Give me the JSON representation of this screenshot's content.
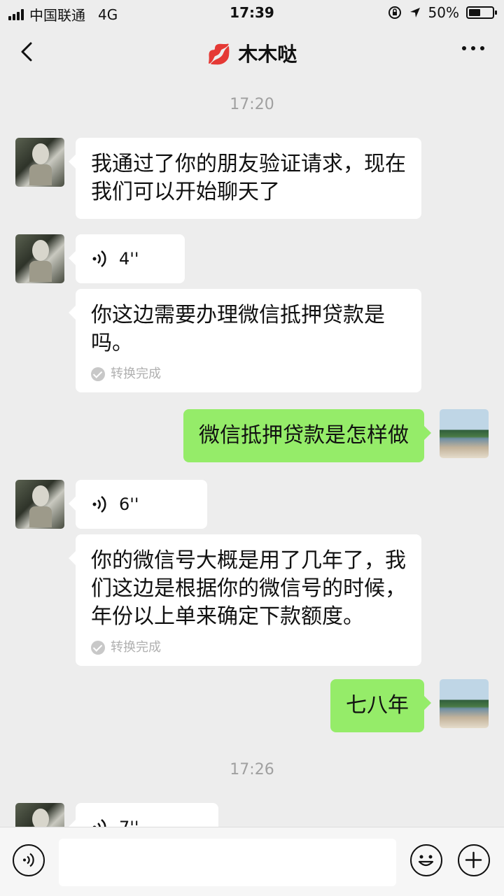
{
  "status_bar": {
    "carrier": "中国联通",
    "network": "4G",
    "time": "17:39",
    "battery": "50%",
    "battery_level": 0.5
  },
  "header": {
    "title": "木木哒",
    "title_emoji": "💋"
  },
  "messages": {
    "ts1": "17:20",
    "m1": {
      "text": "我通过了你的朋友验证请求，现在我们可以开始聊天了"
    },
    "m2": {
      "duration": "4''"
    },
    "m3": {
      "text": "你这边需要办理微信抵押贷款是吗。",
      "status": "转换完成"
    },
    "m4": {
      "text": "微信抵押贷款是怎样做"
    },
    "m5": {
      "duration": "6''"
    },
    "m6": {
      "text": "你的微信号大概是用了几年了，我们这边是根据你的微信号的时候，年份以上单来确定下款额度。",
      "status": "转换完成"
    },
    "m7": {
      "text": "七八年"
    },
    "ts2": "17:26",
    "m8": {
      "duration": "7''"
    }
  },
  "input_bar": {
    "placeholder": ""
  },
  "colors": {
    "background": "#ededed",
    "bubble_mine": "#95ec69",
    "bubble_theirs": "#ffffff"
  }
}
